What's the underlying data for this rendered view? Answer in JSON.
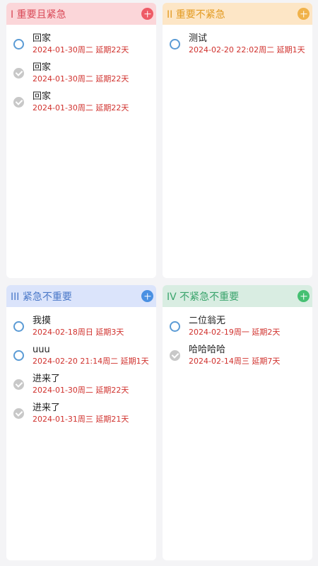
{
  "colors": {
    "q1_header_bg": "#fbd6d9",
    "q1_title": "#d94a58",
    "q1_add": "#ee5b66",
    "q2_header_bg": "#fde6c6",
    "q2_title": "#e39b22",
    "q2_add": "#f0b24a",
    "q3_header_bg": "#dbe4fb",
    "q3_title": "#4a78c8",
    "q3_add": "#4a90e2",
    "q4_header_bg": "#d9ede2",
    "q4_title": "#3aa46c",
    "q4_add": "#45c072",
    "due_text": "#d0312d"
  },
  "quadrants": [
    {
      "title": "I 重要且紧急",
      "items": [
        {
          "title": "回家",
          "date": "2024-01-30周二  延期22天",
          "done": false
        },
        {
          "title": "回家",
          "date": "2024-01-30周二  延期22天",
          "done": true
        },
        {
          "title": "回家",
          "date": "2024-01-30周二  延期22天",
          "done": true
        }
      ]
    },
    {
      "title": "II 重要不紧急",
      "items": [
        {
          "title": "测试",
          "date": "2024-02-20 22:02周二  延期1天",
          "done": false
        }
      ]
    },
    {
      "title": "III 紧急不重要",
      "items": [
        {
          "title": "我摸",
          "date": "2024-02-18周日  延期3天",
          "done": false
        },
        {
          "title": "uuu",
          "date": "2024-02-20 21:14周二  延期1天",
          "done": false
        },
        {
          "title": "进来了",
          "date": "2024-01-30周二  延期22天",
          "done": true
        },
        {
          "title": "进来了",
          "date": "2024-01-31周三  延期21天",
          "done": true
        }
      ]
    },
    {
      "title": "IV 不紧急不重要",
      "items": [
        {
          "title": "二位翁无",
          "date": "2024-02-19周一  延期2天",
          "done": false
        },
        {
          "title": "哈哈哈哈",
          "date": "2024-02-14周三  延期7天",
          "done": true
        }
      ]
    }
  ]
}
